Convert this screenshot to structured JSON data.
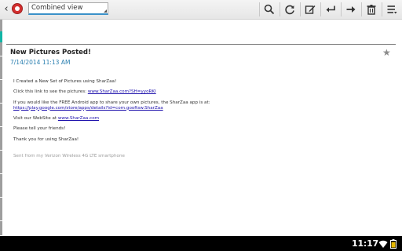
{
  "toolbar": {
    "view_select_value": "Combined view",
    "back_glyph": "‹",
    "icons": [
      "back-icon",
      "app-logo-icon",
      "search-icon",
      "refresh-icon",
      "compose-icon",
      "reply-icon",
      "forward-icon",
      "delete-icon",
      "overflow-menu-icon"
    ]
  },
  "message": {
    "subject": "New Pictures Posted!",
    "date": "7/14/2014  11:13 AM",
    "starred": false,
    "body": {
      "line1": "I Created a New Set of Pictures using SharZaa!",
      "line2_prefix": "Click this link to see the pictures: ",
      "line2_link": "www.SharZaa.com?SH=yyoRKI",
      "line3": "If you would like the FREE Android app to share your own pictures, the SharZaa app is at:",
      "line3_link": "https://play.google.com/store/apps/details?id=com.gooftsw.SharZaa",
      "line4_prefix": "Visit our WebSite at ",
      "line4_link": "www.SharZaa.com",
      "line5": "Please tell your friends!",
      "line6": "Thank you for using SharZaa!",
      "signature": "Sent from my Verizon Wireless 4G LTE smartphone"
    }
  },
  "status_bar": {
    "time": "11:17",
    "icons": [
      "wifi-icon",
      "battery-icon"
    ]
  },
  "colors": {
    "accent_teal": "#12b5a6",
    "date_blue": "#2a7fb0",
    "link_blue": "#1a0dab"
  }
}
